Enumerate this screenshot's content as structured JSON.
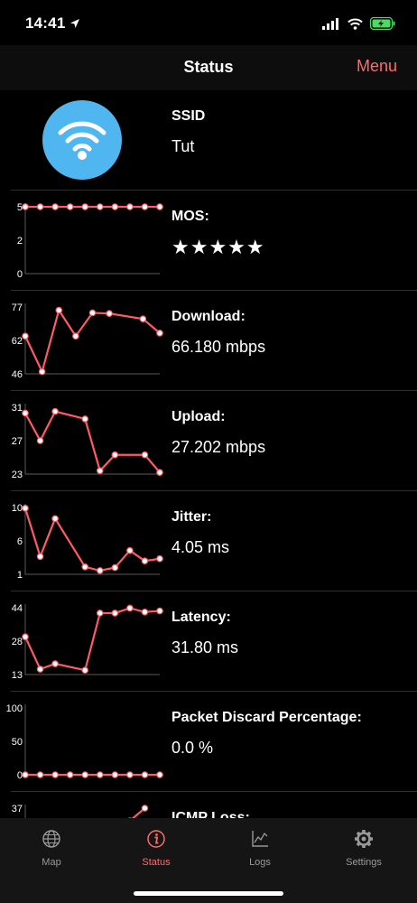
{
  "status_bar": {
    "time": "14:41"
  },
  "nav": {
    "title": "Status",
    "menu_label": "Menu"
  },
  "ssid": {
    "label": "SSID",
    "value": "Tut"
  },
  "metrics": [
    {
      "label": "MOS:",
      "value": "★★★★★",
      "ticks": [
        "5",
        "2",
        "0"
      ],
      "ymin": 0,
      "ymax": 5,
      "points": [
        5,
        5,
        5,
        5,
        5,
        5,
        5,
        5,
        5,
        5
      ]
    },
    {
      "label": "Download:",
      "value": "66.180 mbps",
      "ticks": [
        "77",
        "62",
        "46"
      ],
      "ymin": 46,
      "ymax": 77,
      "points": [
        63.5,
        47,
        75.5,
        63.5,
        74.3,
        74,
        null,
        71.5,
        64.9
      ]
    },
    {
      "label": "Upload:",
      "value": "27.202 mbps",
      "ticks": [
        "31",
        "27",
        "23"
      ],
      "ymin": 23,
      "ymax": 31,
      "points": [
        30.3,
        27,
        30.5,
        null,
        29.6,
        23.4,
        25.3,
        null,
        25.3,
        23.2
      ]
    },
    {
      "label": "Jitter:",
      "value": "4.05 ms",
      "ticks": [
        "10",
        "6",
        "1"
      ],
      "ymin": 1,
      "ymax": 10,
      "points": [
        9.9,
        3.4,
        8.5,
        null,
        2,
        1.5,
        1.9,
        4.2,
        2.8,
        3.1
      ]
    },
    {
      "label": "Latency:",
      "value": "31.80 ms",
      "ticks": [
        "44",
        "28",
        "13"
      ],
      "ymin": 13,
      "ymax": 44,
      "points": [
        30.5,
        15.5,
        18,
        null,
        15,
        41.5,
        41.5,
        43.8,
        42,
        42.5
      ]
    },
    {
      "label": "Packet Discard Percentage:",
      "value": "0.0 %",
      "ticks": [
        "100",
        "50",
        "0"
      ],
      "ymin": 0,
      "ymax": 100,
      "points": [
        0,
        0,
        0,
        0,
        0,
        0,
        0,
        0,
        0,
        0
      ]
    },
    {
      "label": "ICMP Loss:",
      "value": "",
      "ticks": [
        "37",
        "",
        ""
      ],
      "ymin": 0,
      "ymax": 37,
      "points": [
        25,
        25,
        25,
        25,
        25,
        25,
        25,
        30,
        37,
        null
      ]
    }
  ],
  "tabs": [
    {
      "label": "Map",
      "icon": "globe-icon"
    },
    {
      "label": "Status",
      "icon": "info-icon",
      "active": true
    },
    {
      "label": "Logs",
      "icon": "chart-icon"
    },
    {
      "label": "Settings",
      "icon": "gear-icon"
    }
  ],
  "colors": {
    "accent": "#ff6b6b",
    "line": "#ff5a66",
    "ssid_circle": "#4fb6f0"
  }
}
